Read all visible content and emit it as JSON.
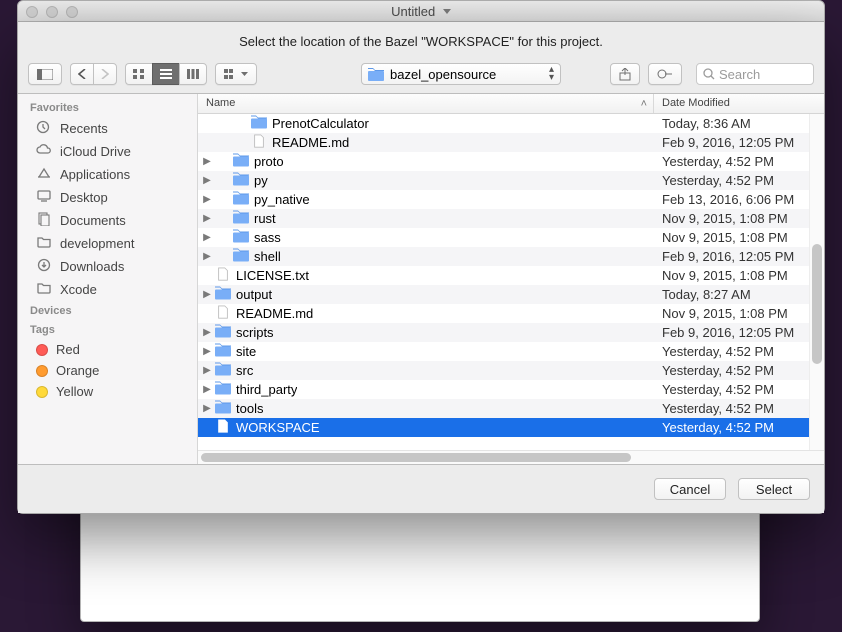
{
  "window": {
    "title": "Untitled"
  },
  "prompt": "Select the location of the Bazel \"WORKSPACE\" for this project.",
  "toolbar": {
    "path_label": "bazel_opensource",
    "search_placeholder": "Search"
  },
  "sidebar": {
    "groups": [
      {
        "label": "Favorites",
        "items": [
          {
            "label": "Recents",
            "icon": "clock-icon"
          },
          {
            "label": "iCloud Drive",
            "icon": "cloud-icon"
          },
          {
            "label": "Applications",
            "icon": "apps-icon"
          },
          {
            "label": "Desktop",
            "icon": "desktop-icon"
          },
          {
            "label": "Documents",
            "icon": "documents-icon"
          },
          {
            "label": "development",
            "icon": "folder-icon"
          },
          {
            "label": "Downloads",
            "icon": "downloads-icon"
          },
          {
            "label": "Xcode",
            "icon": "folder-icon"
          }
        ]
      },
      {
        "label": "Devices",
        "items": []
      },
      {
        "label": "Tags",
        "items": [
          {
            "label": "Red",
            "icon": "tag-dot",
            "color": "#ff5b56"
          },
          {
            "label": "Orange",
            "icon": "tag-dot",
            "color": "#ff9b2f"
          },
          {
            "label": "Yellow",
            "icon": "tag-dot",
            "color": "#ffd93a"
          }
        ]
      }
    ]
  },
  "columns": {
    "name": "Name",
    "date": "Date Modified"
  },
  "rows": [
    {
      "name": "PrenotCalculator",
      "date": "Today, 8:36 AM",
      "kind": "folder",
      "indent": 2,
      "expandable": false
    },
    {
      "name": "README.md",
      "date": "Feb 9, 2016, 12:05 PM",
      "kind": "file",
      "indent": 2,
      "expandable": false
    },
    {
      "name": "proto",
      "date": "Yesterday, 4:52 PM",
      "kind": "folder",
      "indent": 1,
      "expandable": true
    },
    {
      "name": "py",
      "date": "Yesterday, 4:52 PM",
      "kind": "folder",
      "indent": 1,
      "expandable": true
    },
    {
      "name": "py_native",
      "date": "Feb 13, 2016, 6:06 PM",
      "kind": "folder",
      "indent": 1,
      "expandable": true
    },
    {
      "name": "rust",
      "date": "Nov 9, 2015, 1:08 PM",
      "kind": "folder",
      "indent": 1,
      "expandable": true
    },
    {
      "name": "sass",
      "date": "Nov 9, 2015, 1:08 PM",
      "kind": "folder",
      "indent": 1,
      "expandable": true
    },
    {
      "name": "shell",
      "date": "Feb 9, 2016, 12:05 PM",
      "kind": "folder",
      "indent": 1,
      "expandable": true
    },
    {
      "name": "LICENSE.txt",
      "date": "Nov 9, 2015, 1:08 PM",
      "kind": "file",
      "indent": 0,
      "expandable": false
    },
    {
      "name": "output",
      "date": "Today, 8:27 AM",
      "kind": "folder",
      "indent": 0,
      "expandable": true
    },
    {
      "name": "README.md",
      "date": "Nov 9, 2015, 1:08 PM",
      "kind": "file",
      "indent": 0,
      "expandable": false
    },
    {
      "name": "scripts",
      "date": "Feb 9, 2016, 12:05 PM",
      "kind": "folder",
      "indent": 0,
      "expandable": true
    },
    {
      "name": "site",
      "date": "Yesterday, 4:52 PM",
      "kind": "folder",
      "indent": 0,
      "expandable": true
    },
    {
      "name": "src",
      "date": "Yesterday, 4:52 PM",
      "kind": "folder",
      "indent": 0,
      "expandable": true
    },
    {
      "name": "third_party",
      "date": "Yesterday, 4:52 PM",
      "kind": "folder",
      "indent": 0,
      "expandable": true
    },
    {
      "name": "tools",
      "date": "Yesterday, 4:52 PM",
      "kind": "folder",
      "indent": 0,
      "expandable": true
    },
    {
      "name": "WORKSPACE",
      "date": "Yesterday, 4:52 PM",
      "kind": "file",
      "indent": 0,
      "expandable": false,
      "selected": true
    }
  ],
  "footer": {
    "cancel": "Cancel",
    "select": "Select"
  }
}
